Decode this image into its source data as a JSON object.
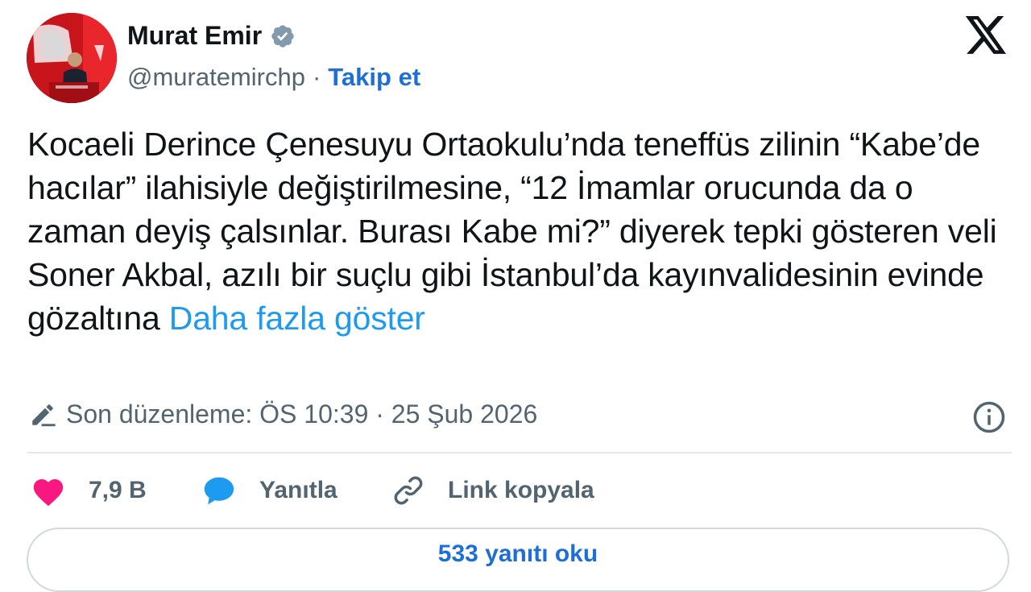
{
  "author": {
    "name": "Murat Emir",
    "handle": "@muratemirchp",
    "separator": "·",
    "follow_label": "Takip et"
  },
  "tweet": {
    "text": "Kocaeli Derince Çenesuyu Ortaokulu’nda teneffüs zilinin “Kabe’de hacılar” ilahisiyle değiştirilmesine, “12 İmamlar orucunda da o zaman deyiş çalsınlar. Burası Kabe mi?” diyerek tepki gösteren veli Soner Akbal, azılı bir suçlu gibi İstanbul’da kayınvalidesinin evinde gözaltına ",
    "show_more": "Daha fazla göster"
  },
  "edit_info": "Son düzenleme: ÖS 10:39 · 25 Şub 2026",
  "actions": {
    "likes": "7,9 B",
    "reply": "Yanıtla",
    "copy_link": "Link kopyala"
  },
  "read_replies": "533 yanıtı oku",
  "colors": {
    "like": "#f91880",
    "reply_icon": "#1d9bf0",
    "link": "#1d9bf0",
    "follow": "#1d6fd6",
    "text": "#0f1419",
    "muted": "#536471"
  }
}
